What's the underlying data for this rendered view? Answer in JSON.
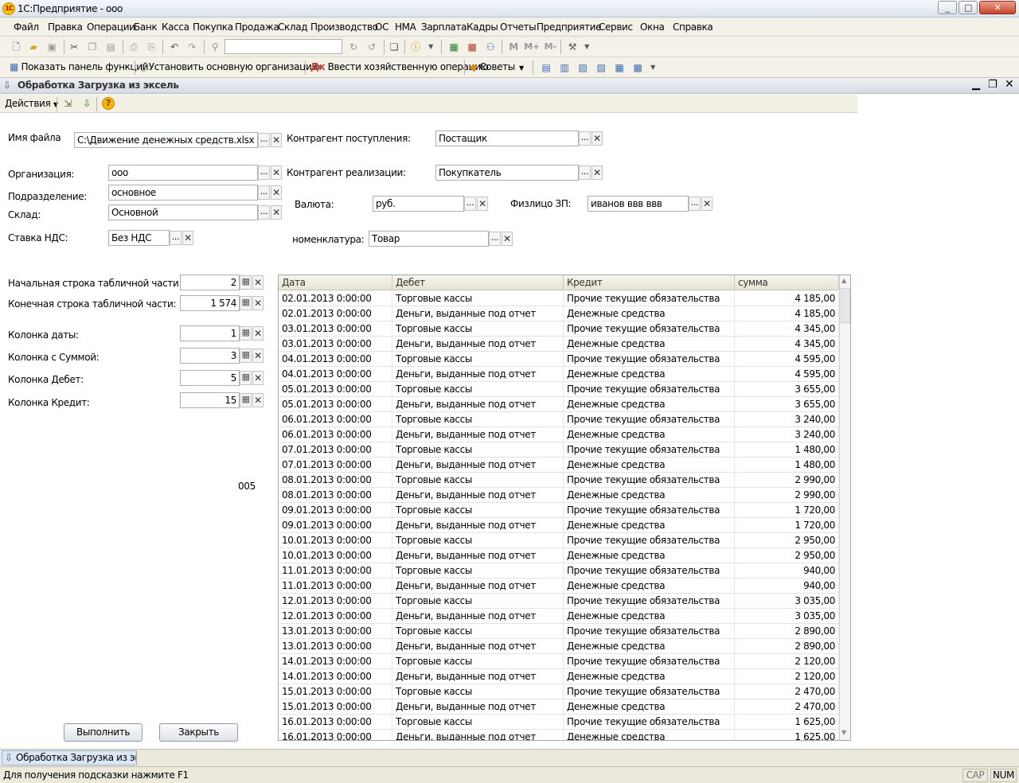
{
  "window": {
    "title": "1С:Предприятие - ооо",
    "logo_text": "1С",
    "min": "_",
    "max": "□",
    "close": "✕"
  },
  "menu": [
    "Файл",
    "Правка",
    "Операции",
    "Банк",
    "Касса",
    "Покупка",
    "Продажа",
    "Склад",
    "Производство",
    "ОС",
    "НМА",
    "Зарплата",
    "Кадры",
    "Отчеты",
    "Предприятие",
    "Сервис",
    "Окна",
    "Справка"
  ],
  "toolbar2": {
    "show_panel": "Показать панель функций",
    "set_org": "Установить основную организацию",
    "enter_op": "Ввести хозяйственную операцию",
    "tips": "Советы"
  },
  "doc": {
    "title": "Обработка  Загрузка из эксель",
    "actions": "Действия"
  },
  "form": {
    "file_label": "Имя файла",
    "file_value": "C:\\Движение денежных средств.xlsx",
    "org_label": "Организация:",
    "org_value": "ооо",
    "div_label": "Подразделение:",
    "div_value": "основное",
    "wh_label": "Склад:",
    "wh_value": "Основной",
    "vat_label": "Ставка НДС:",
    "vat_value": "Без НДС",
    "cp_in_label": "Контрагент поступления:",
    "cp_in_value": "Постащик",
    "cp_out_label": "Контрагент реализации:",
    "cp_out_value": "Покупкатель",
    "cur_label": "Валюта:",
    "cur_value": "руб.",
    "person_label": "Физлицо ЗП:",
    "person_value": "иванов ввв ввв",
    "nom_label": "номенклатура:",
    "nom_value": "Товар",
    "start_label": "Начальная строка табличной части:",
    "start_value": "2",
    "end_label": "Конечная строка  табличной части:",
    "end_value": "1 574",
    "date_col_label": "Колонка даты:",
    "date_col_value": "1",
    "sum_col_label": "Колонка с Суммой:",
    "sum_col_value": "3",
    "debit_col_label": "Колонка Дебет:",
    "debit_col_value": "5",
    "credit_col_label": "Колонка Кредит:",
    "credit_col_value": "15",
    "counter": "005",
    "run_button": "Выполнить",
    "close_button": "Закрыть"
  },
  "grid": {
    "columns": [
      "Дата",
      "Дебет",
      "Кредит",
      "сумма"
    ],
    "rows": [
      [
        "02.01.2013 0:00:00",
        "Торговые кассы",
        "Прочие текущие обязательства",
        "4 185,00"
      ],
      [
        "02.01.2013 0:00:00",
        "Деньги, выданные под отчет",
        "Денежные средства",
        "4 185,00"
      ],
      [
        "03.01.2013 0:00:00",
        "Торговые кассы",
        "Прочие текущие обязательства",
        "4 345,00"
      ],
      [
        "03.01.2013 0:00:00",
        "Деньги, выданные под отчет",
        "Денежные средства",
        "4 345,00"
      ],
      [
        "04.01.2013 0:00:00",
        "Торговые кассы",
        "Прочие текущие обязательства",
        "4 595,00"
      ],
      [
        "04.01.2013 0:00:00",
        "Деньги, выданные под отчет",
        "Денежные средства",
        "4 595,00"
      ],
      [
        "05.01.2013 0:00:00",
        "Торговые кассы",
        "Прочие текущие обязательства",
        "3 655,00"
      ],
      [
        "05.01.2013 0:00:00",
        "Деньги, выданные под отчет",
        "Денежные средства",
        "3 655,00"
      ],
      [
        "06.01.2013 0:00:00",
        "Торговые кассы",
        "Прочие текущие обязательства",
        "3 240,00"
      ],
      [
        "06.01.2013 0:00:00",
        "Деньги, выданные под отчет",
        "Денежные средства",
        "3 240,00"
      ],
      [
        "07.01.2013 0:00:00",
        "Торговые кассы",
        "Прочие текущие обязательства",
        "1 480,00"
      ],
      [
        "07.01.2013 0:00:00",
        "Деньги, выданные под отчет",
        "Денежные средства",
        "1 480,00"
      ],
      [
        "08.01.2013 0:00:00",
        "Торговые кассы",
        "Прочие текущие обязательства",
        "2 990,00"
      ],
      [
        "08.01.2013 0:00:00",
        "Деньги, выданные под отчет",
        "Денежные средства",
        "2 990,00"
      ],
      [
        "09.01.2013 0:00:00",
        "Торговые кассы",
        "Прочие текущие обязательства",
        "1 720,00"
      ],
      [
        "09.01.2013 0:00:00",
        "Деньги, выданные под отчет",
        "Денежные средства",
        "1 720,00"
      ],
      [
        "10.01.2013 0:00:00",
        "Торговые кассы",
        "Прочие текущие обязательства",
        "2 950,00"
      ],
      [
        "10.01.2013 0:00:00",
        "Деньги, выданные под отчет",
        "Денежные средства",
        "2 950,00"
      ],
      [
        "11.01.2013 0:00:00",
        "Торговые кассы",
        "Прочие текущие обязательства",
        "940,00"
      ],
      [
        "11.01.2013 0:00:00",
        "Деньги, выданные под отчет",
        "Денежные средства",
        "940,00"
      ],
      [
        "12.01.2013 0:00:00",
        "Торговые кассы",
        "Прочие текущие обязательства",
        "3 035,00"
      ],
      [
        "12.01.2013 0:00:00",
        "Деньги, выданные под отчет",
        "Денежные средства",
        "3 035,00"
      ],
      [
        "13.01.2013 0:00:00",
        "Торговые кассы",
        "Прочие текущие обязательства",
        "2 890,00"
      ],
      [
        "13.01.2013 0:00:00",
        "Деньги, выданные под отчет",
        "Денежные средства",
        "2 890,00"
      ],
      [
        "14.01.2013 0:00:00",
        "Торговые кассы",
        "Прочие текущие обязательства",
        "2 120,00"
      ],
      [
        "14.01.2013 0:00:00",
        "Деньги, выданные под отчет",
        "Денежные средства",
        "2 120,00"
      ],
      [
        "15.01.2013 0:00:00",
        "Торговые кассы",
        "Прочие текущие обязательства",
        "2 470,00"
      ],
      [
        "15.01.2013 0:00:00",
        "Деньги, выданные под отчет",
        "Денежные средства",
        "2 470,00"
      ],
      [
        "16.01.2013 0:00:00",
        "Торговые кассы",
        "Прочие текущие обязательства",
        "1 625,00"
      ],
      [
        "16.01.2013 0:00:00",
        "Деньги, выданные под отчет",
        "Денежные средства",
        "1 625,00"
      ]
    ]
  },
  "taskbar": {
    "item": "Обработка  Загрузка из эк..."
  },
  "status": {
    "hint": "Для получения подсказки нажмите F1",
    "cap": "CAP",
    "num": "NUM"
  }
}
